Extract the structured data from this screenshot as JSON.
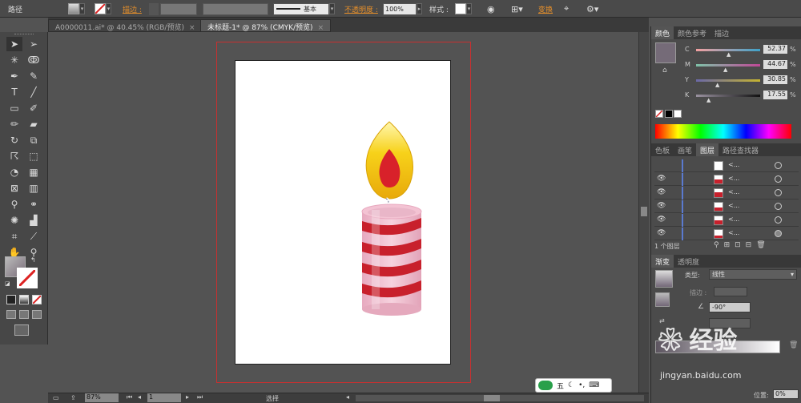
{
  "control_bar": {
    "object_type": "路径",
    "stroke_label": "描边 :",
    "stroke_style": "基本",
    "opacity_label": "不透明度 :",
    "opacity_value": "100%",
    "style_label": "样式 :",
    "transform_label": "变换"
  },
  "tabs": [
    {
      "label": "A0000011.ai* @ 40.45% (RGB/预览)"
    },
    {
      "label": "未标题-1* @ 87% (CMYK/预览)"
    }
  ],
  "color_panel": {
    "tabs": [
      "颜色",
      "颜色参考",
      "描边"
    ],
    "channels": [
      {
        "name": "C",
        "value": "52.37"
      },
      {
        "name": "M",
        "value": "44.67"
      },
      {
        "name": "Y",
        "value": "30.85"
      },
      {
        "name": "K",
        "value": "17.55"
      }
    ],
    "percent": "%"
  },
  "layers_panel": {
    "tabs": [
      "色板",
      "画笔",
      "图层",
      "路径查找器"
    ],
    "rows": [
      {
        "name": "<..."
      },
      {
        "name": "<..."
      },
      {
        "name": "<..."
      },
      {
        "name": "<..."
      },
      {
        "name": "<..."
      },
      {
        "name": "<..."
      }
    ],
    "footer": "1 个图层"
  },
  "gradient_panel": {
    "tabs": [
      "渐变",
      "透明度"
    ],
    "type_label": "类型:",
    "type_value": "线性",
    "stroke_label": "描边 :",
    "angle_value": "-90°",
    "position_label": "位置:",
    "position_value": "0%"
  },
  "status_bar": {
    "zoom": "87%",
    "page": "1",
    "tool": "选择"
  },
  "watermark": {
    "brand": "Baidu",
    "text": "经验",
    "url": "jingyan.baidu.com"
  },
  "ime": {
    "label": "五"
  },
  "colors": {
    "ui_dark": "#535353",
    "bleed": "#c83030",
    "candle_red": "#c8202c",
    "candle_pink": "#f2c4d4",
    "flame_yellow": "#f7d21a"
  }
}
